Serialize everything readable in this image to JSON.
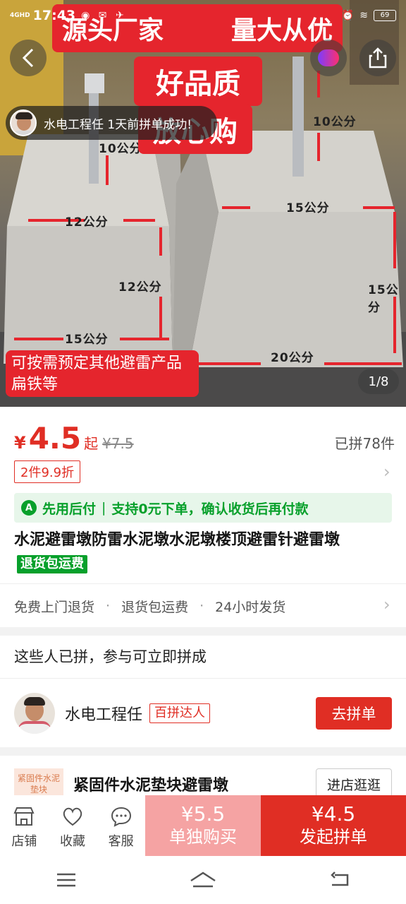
{
  "status_bar": {
    "network": "4GHD",
    "time": "17:43",
    "battery": "69"
  },
  "hero": {
    "banner_top_left": "源头厂家",
    "banner_top_right": "量大从优",
    "banner_mid_1": "好品质",
    "banner_mid_2": "放心购",
    "banner_bottom": "可按需预定其他避雷产品扁铁等",
    "dimensions": {
      "d1": "10公分",
      "d2": "10公分",
      "d3": "12公分",
      "d4": "15公分",
      "d5": "12公分",
      "d6": "15公分",
      "d7": "15公分",
      "d8": "20公分"
    },
    "joined_toast": "水电工程任 1天前拼单成功!",
    "page_indicator": "1/8"
  },
  "price": {
    "currency": "¥",
    "value": "4.5",
    "from_label": "起",
    "original": "¥7.5",
    "sold": "已拼78件",
    "discount_tag": "2件9.9折"
  },
  "paylater": {
    "icon": "A",
    "label": "先用后付",
    "separator": "|",
    "text": "支持0元下单，确认收货后再付款"
  },
  "product": {
    "title": "水泥避雷墩防雷水泥墩水泥墩楼顶避雷针避雷墩",
    "tag": "退货包运费"
  },
  "services": [
    "免费上门退货",
    "退货包运费",
    "24小时发货"
  ],
  "service_separator": "·",
  "group": {
    "heading": "这些人已拼，参与可立即拼成",
    "user_name": "水电工程任",
    "user_badge": "百拼达人",
    "join_label": "去拼单"
  },
  "shop": {
    "thumb_text": "紧固件水泥垫块",
    "name": "紧固件水泥垫块避雷墩",
    "visit_label": "进店逛逛"
  },
  "action_bar": {
    "store": "店铺",
    "favorite": "收藏",
    "service": "客服",
    "single_price": "¥5.5",
    "single_label": "单独购买",
    "group_price": "¥4.5",
    "group_label": "发起拼单"
  },
  "colors": {
    "accent_red": "#e02e24",
    "banner_red": "#e5252d",
    "green": "#07a02b",
    "single_buy_pink": "#f5a3a3"
  }
}
